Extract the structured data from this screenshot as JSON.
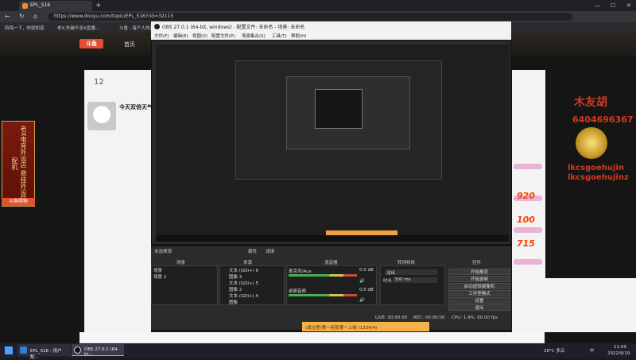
{
  "browser": {
    "tab_title": "EPL_S16",
    "new_tab": "+",
    "url": "https://www.douyu.com/topic/EPL_S16?rid=32115",
    "bookmarks": [
      "四海一下，你就知道",
      "老X,先破不全X直播...",
      "斗鱼 - 每个人的直..."
    ]
  },
  "site": {
    "logo": "斗鱼",
    "nav_home": "首页",
    "follower_count": "12",
    "card_title": "今天双倍天气",
    "vertical_banner": "老X电竞外设店 悬挂外设装配机",
    "vertical_button": "斗鱼购物",
    "overlay_name": "木友胡",
    "overlay_number": "6404696367",
    "overlay_tag1": "lkcsgoehujin",
    "overlay_tag2": "lkcsgoehujinz",
    "badges": [
      "920",
      "100",
      "715"
    ],
    "bottom_banner": "(请注意)第一组有第一上线 (1234/4)"
  },
  "obs": {
    "title": "OBS 27.0.1 (64-bit, windows) - 配置文件: 未命名 - 场景: 未命名",
    "menu": [
      "文件(F)",
      "编辑(E)",
      "视图(V)",
      "配置文件(P)",
      "场景集合(S)",
      "工具(T)",
      "帮助(H)"
    ],
    "preview_label": "未选择源",
    "properties": "属性",
    "filters": "滤镜",
    "docks": {
      "scenes": "场景",
      "sources": "来源",
      "mixer": "混音器",
      "transitions": "转场特效",
      "controls": "控件"
    },
    "scenes": [
      "场景",
      "场景 2"
    ],
    "sources": [
      "文本 (GDI+) 6",
      "图像 3",
      "文本 (GDI+) 5",
      "图像 2",
      "文本 (GDI+) 4",
      "图像"
    ],
    "mixer": {
      "track1": "麦克风/Aux",
      "track1_db": "0.0 dB",
      "track2": "桌面音频",
      "track2_db": "0.0 dB"
    },
    "transitions": {
      "type": "淡出",
      "duration_label": "时长",
      "duration_value": "300 ms"
    },
    "controls": [
      "开始推流",
      "开始录制",
      "启动虚拟摄像机",
      "工作室模式",
      "设置",
      "退出"
    ],
    "status": {
      "live": "LIVE: 00:00:00",
      "rec": "REC: 00:00:00",
      "cpu": "CPU: 1.4%, 60.00 fps"
    }
  },
  "taskbar": {
    "items": [
      "EPL_S16 - 用户配...",
      "OBS 27.0.1 (64-bi..."
    ],
    "weather": "28°C 多云",
    "time": "11:09",
    "date": "2022/9/19",
    "lang": "中"
  }
}
